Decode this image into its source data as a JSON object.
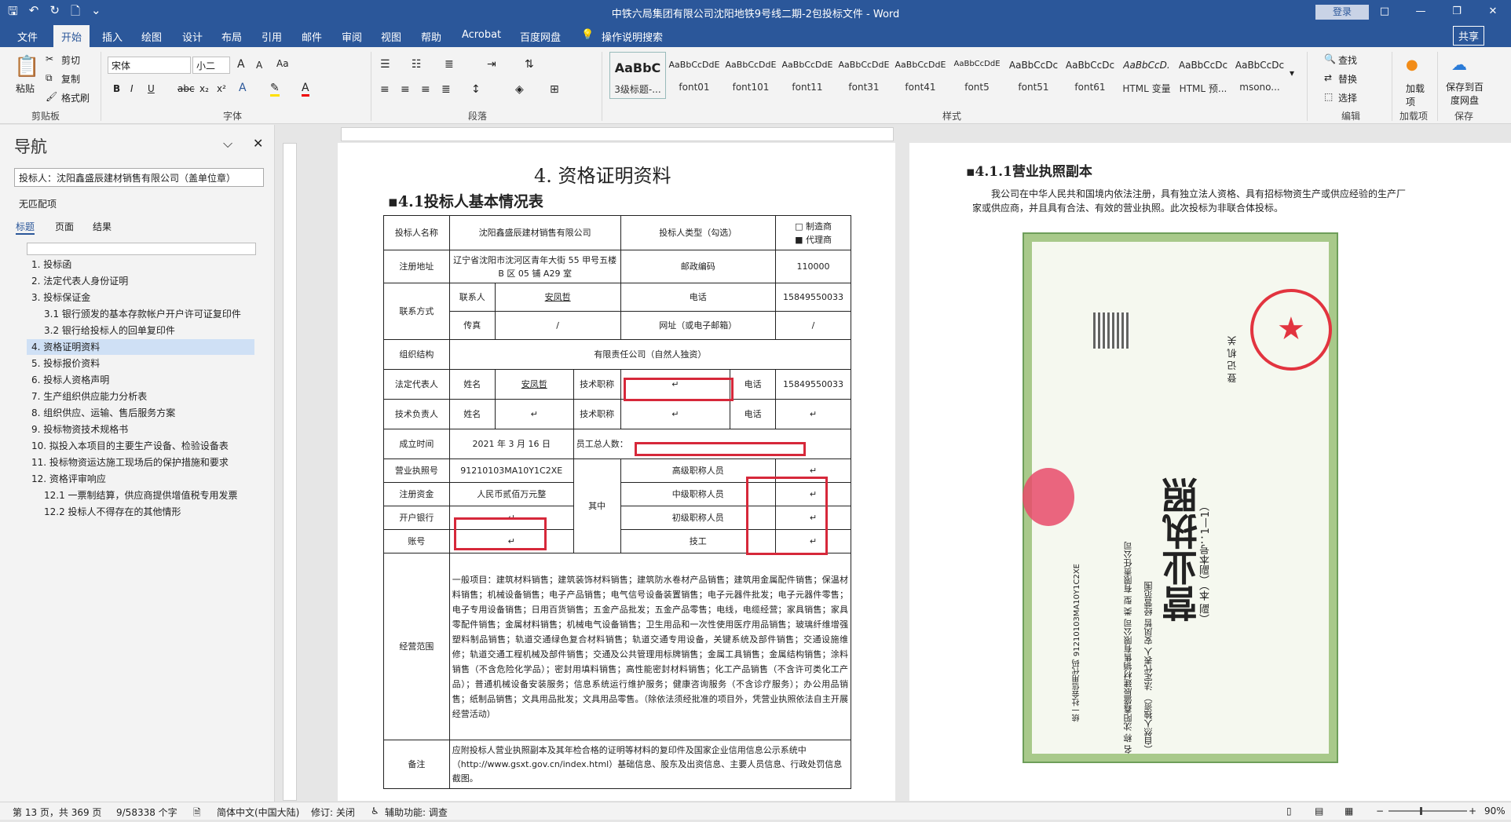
{
  "window": {
    "title": "中铁六局集团有限公司沈阳地铁9号线二期-2包投标文件 - Word",
    "login": "登录",
    "controls": [
      "□",
      "—",
      "❐",
      "✕"
    ]
  },
  "menu": {
    "items": [
      "文件",
      "开始",
      "插入",
      "绘图",
      "设计",
      "布局",
      "引用",
      "邮件",
      "审阅",
      "视图",
      "帮助",
      "Acrobat",
      "百度网盘"
    ],
    "tell_me": "操作说明搜索",
    "share": "共享"
  },
  "ribbon": {
    "clipboard": {
      "paste": "粘贴",
      "cut": "剪切",
      "copy": "复制",
      "format_painter": "格式刷",
      "label": "剪贴板"
    },
    "font": {
      "name": "宋体",
      "size": "小二",
      "label": "字体",
      "bold": "B",
      "italic": "I",
      "underline": "U",
      "strike": "abc",
      "sub": "x₂",
      "sup": "x²",
      "grow": "A",
      "shrink": "A",
      "case": "Aa"
    },
    "paragraph": {
      "label": "段落"
    },
    "styles": {
      "label": "样式",
      "items": [
        {
          "sample": "AaBbC",
          "name": "3级标题-..."
        },
        {
          "sample": "AaBbCcDdE",
          "name": "font01"
        },
        {
          "sample": "AaBbCcDdE",
          "name": "font101"
        },
        {
          "sample": "AaBbCcDdE",
          "name": "font11"
        },
        {
          "sample": "AaBbCcDdE",
          "name": "font31"
        },
        {
          "sample": "AaBbCcDdE",
          "name": "font41"
        },
        {
          "sample": "AaBbCcDdE",
          "name": "font5"
        },
        {
          "sample": "AaBbCcDc",
          "name": "font51"
        },
        {
          "sample": "AaBbCcDc",
          "name": "font61"
        },
        {
          "sample": "AaBbCcD.",
          "name": "HTML 变量"
        },
        {
          "sample": "AaBbCcDc",
          "name": "HTML 预..."
        },
        {
          "sample": "AaBbCcDc",
          "name": "msono..."
        }
      ]
    },
    "editing": {
      "find": "查找",
      "replace": "替换",
      "select": "选择",
      "label": "编辑"
    },
    "addin": {
      "name": "加载项",
      "label": "加载项"
    },
    "save": {
      "name": "保存到百度网盘",
      "label": "保存"
    }
  },
  "nav": {
    "title": "导航",
    "search": "投标人：沈阳鑫盛辰建材销售有限公司（盖单位章）",
    "no_match": "无匹配项",
    "tabs": [
      "标题",
      "页面",
      "结果"
    ],
    "items": [
      {
        "text": "1. 投标函"
      },
      {
        "text": "2. 法定代表人身份证明"
      },
      {
        "text": "3. 投标保证金"
      },
      {
        "text": "3.1 银行颁发的基本存款帐户开户许可证复印件"
      },
      {
        "text": "3.2 银行给投标人的回单复印件"
      },
      {
        "text": "4. 资格证明资料"
      },
      {
        "text": "5. 投标报价资料"
      },
      {
        "text": "6. 投标人资格声明"
      },
      {
        "text": "7. 生产组织供应能力分析表"
      },
      {
        "text": "8. 组织供应、运输、售后服务方案"
      },
      {
        "text": "9. 投标物资技术规格书"
      },
      {
        "text": "10. 拟投入本项目的主要生产设备、检验设备表"
      },
      {
        "text": "11. 投标物资运达施工现场后的保护措施和要求"
      },
      {
        "text": "12. 资格评审响应"
      },
      {
        "text": "12.1 一票制结算，供应商提供增值税专用发票"
      },
      {
        "text": "12.2 投标人不得存在的其他情形"
      }
    ]
  },
  "page1": {
    "heading": "4.    资格证明资料",
    "subheading": "▪4.1投标人基本情况表",
    "table": {
      "bidder_label": "投标人名称",
      "bidder": "沈阳鑫盛辰建材销售有限公司",
      "type_label": "投标人类型（勾选）",
      "type_opt1": "□    制造商",
      "type_opt2": "■    代理商",
      "addr_label": "注册地址",
      "addr": "辽宁省沈阳市沈河区青年大街 55 甲号五楼 B 区 05 铺 A29 室",
      "zip_label": "邮政编码",
      "zip": "110000",
      "contact_label": "联系方式",
      "person_label": "联系人",
      "person": "安凤哲",
      "phone_label": "电话",
      "phone": "15849550033",
      "fax_label": "传真",
      "fax": "/",
      "web_label": "网址（或电子邮箱）",
      "web": "/",
      "org_label": "组织结构",
      "org": "有限责任公司（自然人独资）",
      "legal_label": "法定代表人",
      "name_label": "姓名",
      "legal_name": "安凤哲",
      "title_label": "技术职称",
      "legal_phone": "15849550033",
      "tech_label": "技术负责人",
      "founded_label": "成立时间",
      "founded": "2021 年 3 月 16 日",
      "staff_label": "员工总人数：",
      "license_label": "营业执照号",
      "license": "91210103MA10Y1C2XE",
      "senior": "高级职称人员",
      "capital_label": "注册资金",
      "capital": "人民币贰佰万元整",
      "of_which": "其中",
      "middle": "中级职称人员",
      "bank_label": "开户银行",
      "junior": "初级职称人员",
      "account_label": "账号",
      "worker": "技工",
      "scope_label": "经营范围",
      "scope": "一般项目：建筑材料销售；建筑装饰材料销售；建筑防水卷材产品销售；建筑用金属配件销售；保温材料销售；机械设备销售；电子产品销售；电气信号设备装置销售；电子元器件批发；电子元器件零售；电子专用设备销售；日用百货销售；五金产品批发；五金产品零售；电线，电缆经营；家具销售；家具零配件销售；金属材料销售；机械电气设备销售；卫生用品和一次性使用医疗用品销售；玻璃纤维增强塑料制品销售；轨道交通绿色复合材料销售；轨道交通专用设备，关键系统及部件销售；交通设施维修；轨道交通工程机械及部件销售；交通及公共管理用标牌销售；金属工具销售；金属结构销售；涂料销售（不含危险化学品）；密封用填料销售；高性能密封材料销售；化工产品销售（不含许可类化工产品）；普通机械设备安装服务；信息系统运行维护服务；健康咨询服务（不含诊疗服务）；办公用品销售；纸制品销售；文具用品批发；文具用品零售。（除依法须经批准的项目外，凭营业执照依法自主开展经营活动）",
      "remark_label": "备注",
      "remark": "应附投标人营业执照副本及其年检合格的证明等材料的复印件及国家企业信用信息公示系统中（http://www.gsxt.gov.cn/index.html）基础信息、股东及出资信息、主要人员信息、行政处罚信息截图。",
      "mark": "↵"
    }
  },
  "page2": {
    "subheading": "▪4.1.1营业执照副本",
    "intro": "我公司在中华人民共和国境内依法注册，具有独立法人资格、具有招标物资生产或供应经验的生产厂家或供应商，并且具有合法、有效的营业执照。此次投标为非联合体投标。",
    "license_title": "营业执照",
    "license_sub": "（副  本）（副本号：1—1）",
    "license_code": "统一社会信用代码 91210103MA10Y1C2XE",
    "license_fields": "名 称 沈阳鑫盛辰建材销售有限公司  类 型 有限责任公司（自然人独资）  法定代表人 安凤哲  经营范围",
    "registrar": "登 记 机 关"
  },
  "status": {
    "page": "第 13 页，共 369 页",
    "words": "9/58338 个字",
    "lang": "简体中文(中国大陆)",
    "track": "修订: 关闭",
    "access": "辅助功能: 调查",
    "zoom": "90%"
  }
}
